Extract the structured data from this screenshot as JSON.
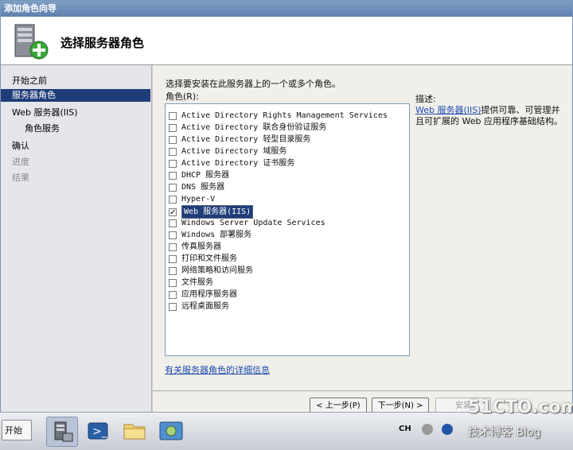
{
  "window": {
    "title": "添加角色向导"
  },
  "header": {
    "title": "选择服务器角色",
    "icon": "server-add-icon"
  },
  "nav": {
    "items": [
      {
        "label": "开始之前",
        "state": "normal"
      },
      {
        "label": "服务器角色",
        "state": "selected"
      },
      {
        "label": "Web 服务器(IIS)",
        "state": "normal"
      },
      {
        "label": "角色服务",
        "state": "sub"
      },
      {
        "label": "确认",
        "state": "normal"
      },
      {
        "label": "进度",
        "state": "disabled"
      },
      {
        "label": "结果",
        "state": "disabled"
      }
    ]
  },
  "content": {
    "instruction": "选择要安装在此服务器上的一个或多个角色。",
    "roles_label": "角色(R):",
    "roles": [
      {
        "label": "Active Directory Rights Management Services",
        "checked": false
      },
      {
        "label": "Active Directory 联合身份验证服务",
        "checked": false
      },
      {
        "label": "Active Directory 轻型目录服务",
        "checked": false
      },
      {
        "label": "Active Directory 域服务",
        "checked": false
      },
      {
        "label": "Active Directory 证书服务",
        "checked": false
      },
      {
        "label": "DHCP 服务器",
        "checked": false
      },
      {
        "label": "DNS 服务器",
        "checked": false
      },
      {
        "label": "Hyper-V",
        "checked": false
      },
      {
        "label": "Web 服务器(IIS)",
        "checked": true
      },
      {
        "label": "Windows Server Update Services",
        "checked": false
      },
      {
        "label": "Windows 部署服务",
        "checked": false
      },
      {
        "label": "传真服务器",
        "checked": false
      },
      {
        "label": "打印和文件服务",
        "checked": false
      },
      {
        "label": "网络策略和访问服务",
        "checked": false
      },
      {
        "label": "文件服务",
        "checked": false
      },
      {
        "label": "应用程序服务器",
        "checked": false
      },
      {
        "label": "远程桌面服务",
        "checked": false
      }
    ],
    "description": {
      "title": "描述:",
      "link": "Web 服务器(IIS)",
      "text": "提供可靠、可管理并且可扩展的 Web 应用程序基础结构。"
    },
    "more_info_link": "有关服务器角色的详细信息"
  },
  "buttons": {
    "back": "< 上一步(P)",
    "next": "下一步(N) >",
    "install": "安装"
  },
  "taskbar": {
    "start_label": "开始",
    "lang": "CH",
    "icons": [
      "server-manager-icon",
      "powershell-icon",
      "explorer-folder-icon",
      "network-icon"
    ]
  },
  "watermark": {
    "line1": "51CTO.com",
    "line2": "技术博客 Blog"
  },
  "colors": {
    "selected": "#1f3d78",
    "link": "#1f4cb0",
    "title_bar": "#5e80ad"
  }
}
